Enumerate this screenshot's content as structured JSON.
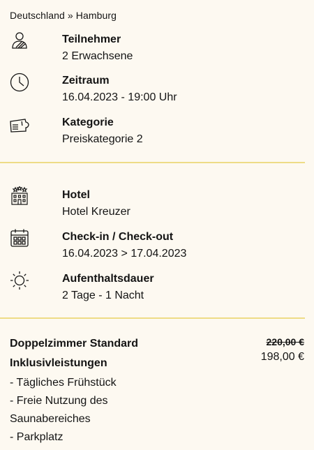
{
  "breadcrumb": "Deutschland » Hamburg",
  "details": {
    "participants": {
      "label": "Teilnehmer",
      "value": "2 Erwachsene",
      "icon": "person-icon"
    },
    "period": {
      "label": "Zeitraum",
      "value": "16.04.2023 - 19:00 Uhr",
      "icon": "clock-icon"
    },
    "category": {
      "label": "Kategorie",
      "value": "Preiskategorie 2",
      "icon": "ticket-icon"
    }
  },
  "hotel": {
    "name": {
      "label": "Hotel",
      "value": "Hotel Kreuzer",
      "icon": "hotel-icon"
    },
    "checkin": {
      "label": "Check-in / Check-out",
      "value": "16.04.2023 > 17.04.2023",
      "icon": "calendar-icon"
    },
    "duration": {
      "label": "Aufenthaltsdauer",
      "value": "2 Tage - 1 Nacht",
      "icon": "sun-icon"
    }
  },
  "room": {
    "title": "Doppelzimmer Standard",
    "old_price": "220,00 €",
    "price": "198,00 €",
    "inclusions_title": "Inklusivleistungen",
    "inclusions": [
      "- Tägliches Frühstück",
      "- Freie Nutzung des Saunabereiches",
      "- Parkplatz"
    ]
  },
  "colors": {
    "background": "#fdf9f1",
    "divider": "#eedc86",
    "text": "#141414"
  }
}
